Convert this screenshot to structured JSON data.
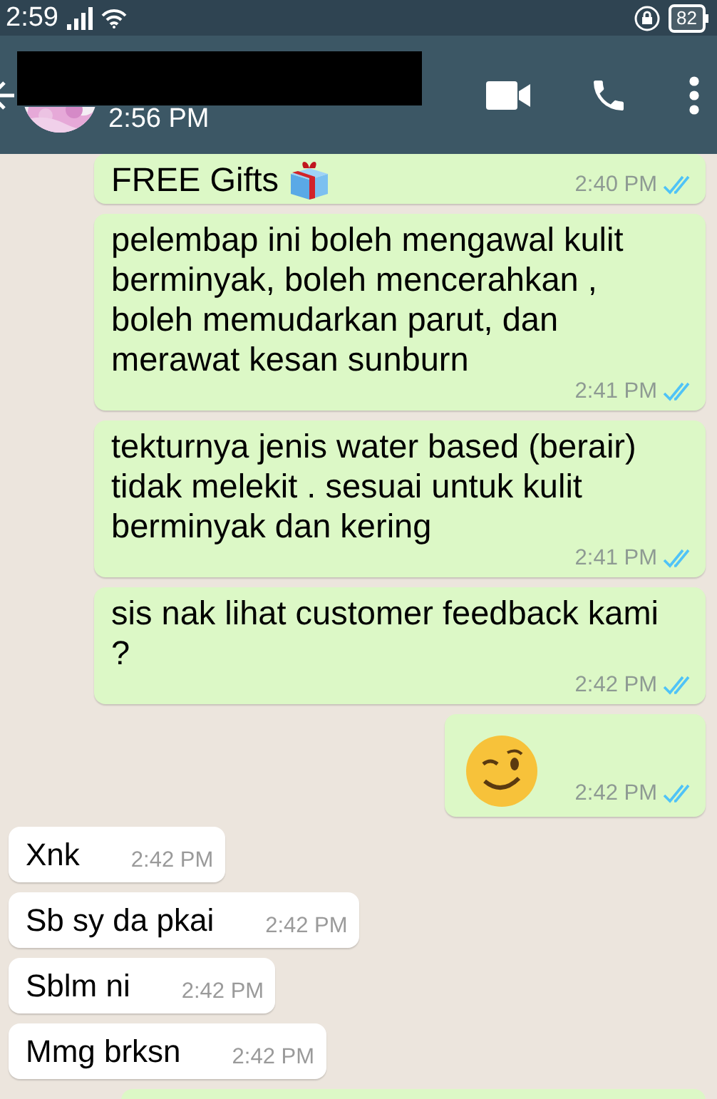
{
  "status_bar": {
    "time": "2:59",
    "battery": "82"
  },
  "header": {
    "subtitle": "2:56 PM",
    "redacted": true
  },
  "messages": [
    {
      "kind": "outgoing",
      "text": "FREE Gifts",
      "gift": true,
      "time": "2:40 PM",
      "read": true
    },
    {
      "kind": "outgoing",
      "text": "pelembap ini boleh mengawal kulit berminyak, boleh mencerahkan , boleh memudarkan parut, dan merawat kesan sunburn",
      "time": "2:41 PM",
      "read": true
    },
    {
      "kind": "outgoing",
      "text": "tekturnya jenis water based (berair) tidak melekit . sesuai untuk kulit berminyak dan kering",
      "time": "2:41 PM",
      "read": true
    },
    {
      "kind": "outgoing",
      "text": "sis nak lihat customer feedback kami ?",
      "time": "2:42 PM",
      "read": true
    },
    {
      "kind": "emoji",
      "time": "2:42 PM",
      "read": true
    },
    {
      "kind": "incoming",
      "text": "Xnk",
      "time": "2:42 PM"
    },
    {
      "kind": "incoming",
      "text": "Sb sy da pkai",
      "time": "2:42 PM"
    },
    {
      "kind": "incoming",
      "text": "Sblm ni",
      "time": "2:42 PM"
    },
    {
      "kind": "incoming",
      "text": "Mmg brksn",
      "time": "2:42 PM"
    },
    {
      "kind": "outgoing-cut"
    }
  ]
}
